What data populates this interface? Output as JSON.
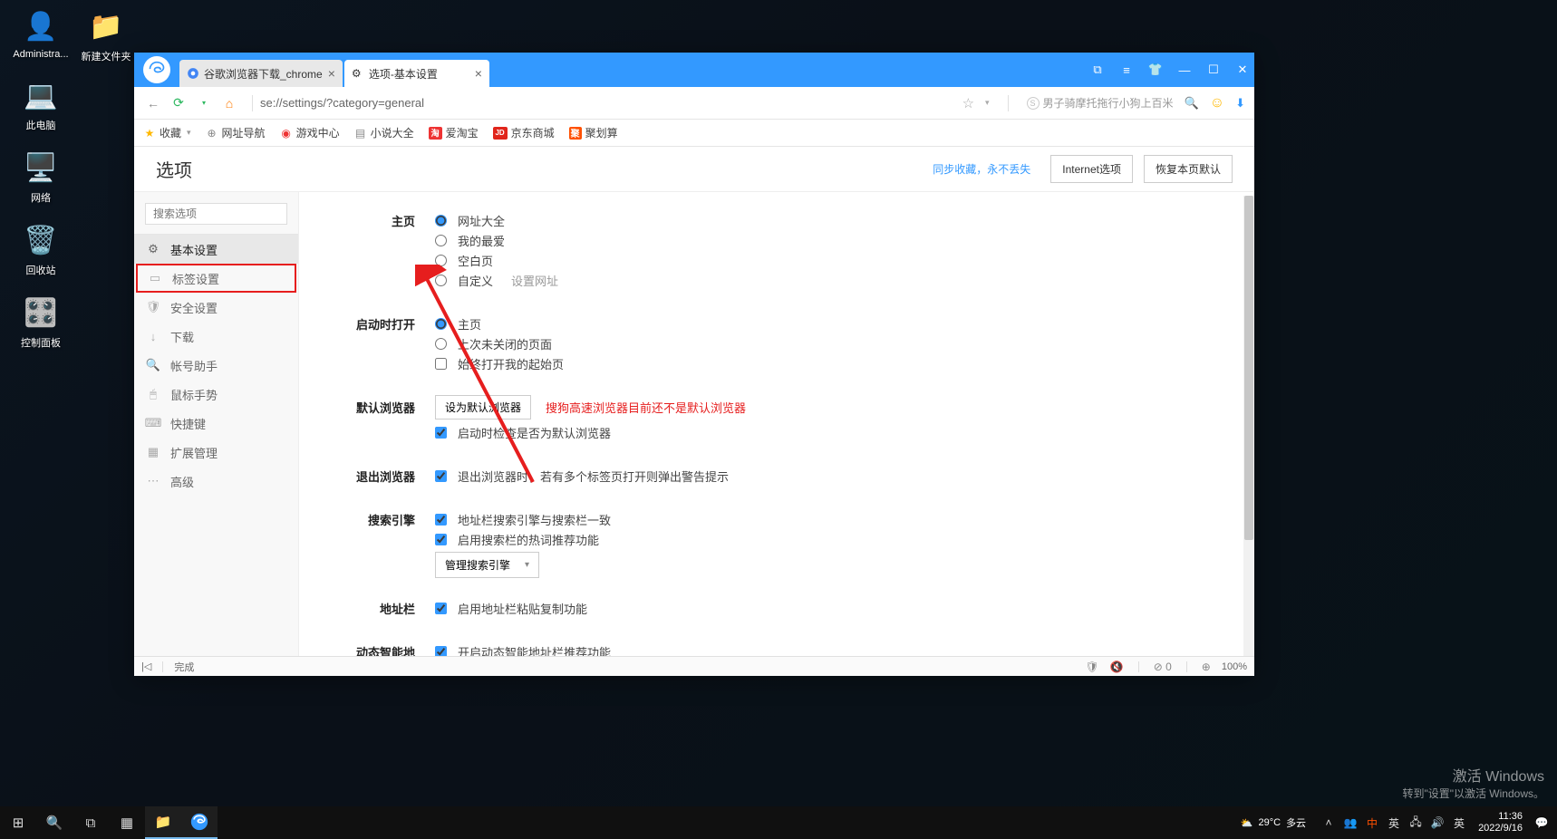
{
  "desktop": {
    "icons": [
      {
        "label": "Administra...",
        "emoji": "👤"
      },
      {
        "label": "此电脑",
        "emoji": "💻"
      },
      {
        "label": "网络",
        "emoji": "🖥️"
      },
      {
        "label": "回收站",
        "emoji": "🗑️"
      },
      {
        "label": "控制面板",
        "emoji": "🎛️"
      }
    ],
    "icon_right": {
      "label": "新建文件夹",
      "emoji": "📁"
    }
  },
  "browser": {
    "tabs": [
      {
        "title": "谷歌浏览器下载_chrome"
      },
      {
        "title": "选项-基本设置"
      }
    ],
    "url": "se://settings/?category=general",
    "search_hint": "男子骑摩托拖行小狗上百米",
    "bookmarks": [
      {
        "label": "收藏",
        "iconClass": "star",
        "glyph": "★"
      },
      {
        "label": "网址导航",
        "iconClass": "globe",
        "glyph": "⊕"
      },
      {
        "label": "游戏中心",
        "iconClass": "game",
        "glyph": "◉"
      },
      {
        "label": "小说大全",
        "iconClass": "book",
        "glyph": "▤"
      },
      {
        "label": "爱淘宝",
        "iconClass": "red",
        "glyph": "淘"
      },
      {
        "label": "京东商城",
        "iconClass": "jd",
        "glyph": "JD"
      },
      {
        "label": "聚划算",
        "iconClass": "ju",
        "glyph": "聚"
      }
    ]
  },
  "page": {
    "title": "选项",
    "sync_link": "同步收藏，永不丢失",
    "internet_btn": "Internet选项",
    "restore_btn": "恢复本页默认"
  },
  "sidebar": {
    "search_placeholder": "搜索选项",
    "items": [
      {
        "label": "基本设置",
        "icon": "⚙"
      },
      {
        "label": "标签设置",
        "icon": "▭"
      },
      {
        "label": "安全设置",
        "icon": "🛡"
      },
      {
        "label": "下载",
        "icon": "↓"
      },
      {
        "label": "帐号助手",
        "icon": "🔍"
      },
      {
        "label": "鼠标手势",
        "icon": "🖱"
      },
      {
        "label": "快捷键",
        "icon": "⌨"
      },
      {
        "label": "扩展管理",
        "icon": "▦"
      },
      {
        "label": "高级",
        "icon": "⋯"
      }
    ]
  },
  "settings": {
    "homepage": {
      "label": "主页",
      "opts": [
        "网址大全",
        "我的最爱",
        "空白页",
        "自定义"
      ],
      "set_url": "设置网址"
    },
    "startup": {
      "label": "启动时打开",
      "opts": [
        "主页",
        "上次未关闭的页面"
      ],
      "always_open": "始终打开我的起始页"
    },
    "default_browser": {
      "label": "默认浏览器",
      "btn": "设为默认浏览器",
      "warn": "搜狗高速浏览器目前还不是默认浏览器",
      "check_on_start": "启动时检查是否为默认浏览器"
    },
    "exit": {
      "label": "退出浏览器",
      "opt": "退出浏览器时，若有多个标签页打开则弹出警告提示"
    },
    "search": {
      "label": "搜索引擎",
      "opt1": "地址栏搜索引擎与搜索栏一致",
      "opt2": "启用搜索栏的热词推荐功能",
      "manage_btn": "管理搜索引擎"
    },
    "addressbar": {
      "label": "地址栏",
      "opt": "启用地址栏粘贴复制功能"
    },
    "dynamic": {
      "label": "动态智能地址栏",
      "opt": "开启动态智能地址栏推荐功能"
    }
  },
  "status_bar": {
    "done": "完成",
    "zoom": "100%",
    "ad_block": "0"
  },
  "taskbar": {
    "weather_temp": "29°C",
    "weather_text": "多云",
    "ime": "英",
    "time": "11:36",
    "date": "2022/9/16"
  },
  "watermark": {
    "line1": "激活 Windows",
    "line2": "转到\"设置\"以激活 Windows。"
  }
}
